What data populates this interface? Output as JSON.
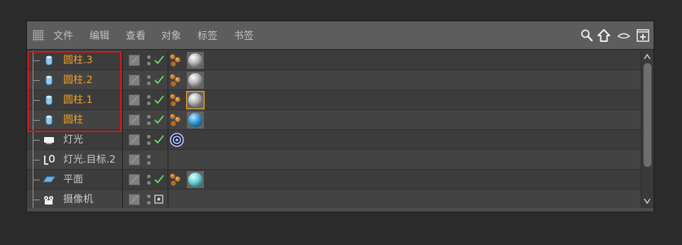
{
  "menu": {
    "items": [
      "文件",
      "编辑",
      "查看",
      "对象",
      "标签",
      "书签"
    ],
    "tools": [
      "search-icon",
      "home-icon",
      "view-toggle-icon",
      "new-panel-icon"
    ]
  },
  "objects": [
    {
      "name": "圆柱.3",
      "icon": "cylinder-icon",
      "selected": true,
      "check": true,
      "tags": [
        "phong-tag-icon",
        "material-tag-icon"
      ],
      "material": "white"
    },
    {
      "name": "圆柱.2",
      "icon": "cylinder-icon",
      "selected": true,
      "check": true,
      "tags": [
        "phong-tag-icon",
        "material-tag-icon"
      ],
      "material": "white"
    },
    {
      "name": "圆柱.1",
      "icon": "cylinder-icon",
      "selected": true,
      "check": true,
      "tags": [
        "phong-tag-icon",
        "material-tag-icon"
      ],
      "material": "white",
      "material_active": true
    },
    {
      "name": "圆柱",
      "icon": "cylinder-icon",
      "selected": true,
      "check": true,
      "tags": [
        "phong-tag-icon",
        "material-tag-icon"
      ],
      "material": "blue"
    },
    {
      "name": "灯光",
      "icon": "light-icon",
      "selected": false,
      "check": true,
      "tags": [
        "target-tag-icon"
      ]
    },
    {
      "name": "灯光.目标.2",
      "icon": "null-target-icon",
      "selected": false,
      "check": false,
      "tags": []
    },
    {
      "name": "平面",
      "icon": "plane-icon",
      "selected": false,
      "check": true,
      "tags": [
        "phong-tag-icon",
        "material-tag-icon"
      ],
      "material": "cyan"
    },
    {
      "name": "摄像机",
      "icon": "camera-icon",
      "selected": false,
      "check": false,
      "tags": []
    }
  ],
  "colors": {
    "selected_text": "#f0a22a",
    "normal_text": "#c8c8c8",
    "check_green": "#6fe06f",
    "highlight_border": "#d21919",
    "menubar_bg": "#5d5d5d"
  }
}
